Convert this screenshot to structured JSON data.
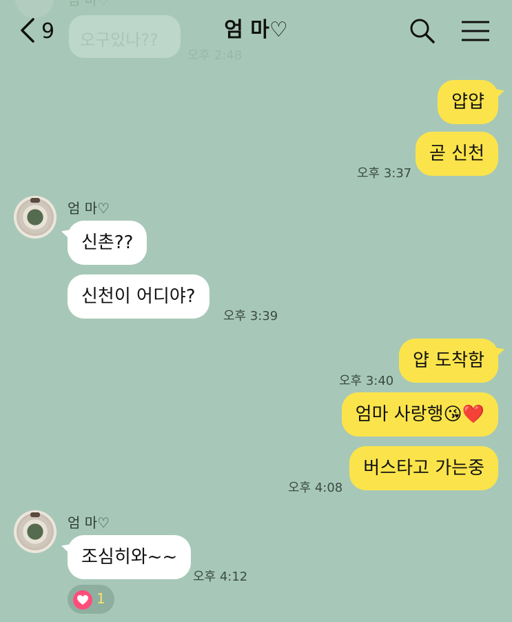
{
  "header": {
    "back_count": "9",
    "title": "엄 마♡",
    "icons": [
      "chevron-left-icon",
      "search-icon",
      "menu-icon"
    ]
  },
  "faded_top": {
    "sender": "엄 마♡",
    "message": "오구있나??",
    "time": "오후 2:48"
  },
  "messages": [
    {
      "from": "me",
      "text": "얍얍"
    },
    {
      "from": "me",
      "text": "곧 신천",
      "time": "오후 3:37"
    },
    {
      "from": "other",
      "sender": "엄 마♡",
      "text": "신촌??"
    },
    {
      "from": "other",
      "text": "신천이  어디야?",
      "time": "오후 3:39"
    },
    {
      "from": "me",
      "text": "얍 도착함",
      "time": "오후 3:40"
    },
    {
      "from": "me",
      "text": "엄마 사랑행😘❤️"
    },
    {
      "from": "me",
      "text": "버스타고 가는중",
      "time": "오후 4:08"
    },
    {
      "from": "other",
      "sender": "엄 마♡",
      "text": "조심히와~~",
      "time": "오후 4:12"
    }
  ],
  "reaction": {
    "icon": "heart-icon",
    "count": "1"
  },
  "colors": {
    "background": "#a7c8b8",
    "my_bubble": "#fbe44b",
    "their_bubble": "#ffffff",
    "reaction_heart": "#ff4d79"
  }
}
